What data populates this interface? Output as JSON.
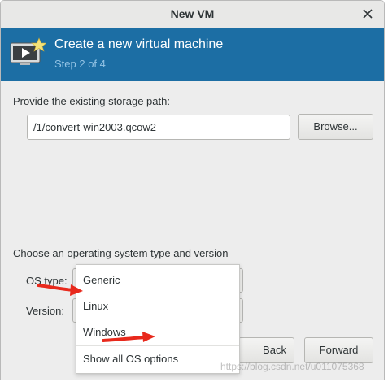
{
  "window": {
    "title": "New VM"
  },
  "banner": {
    "heading": "Create a new virtual machine",
    "step": "Step 2 of 4"
  },
  "storage": {
    "prompt": "Provide the existing storage path:",
    "path_value": "/1/convert-win2003.qcow2",
    "browse_label": "Browse..."
  },
  "os_section": {
    "prompt": "Choose an operating system type and version",
    "os_type_label": "OS type:",
    "version_label": "Version:"
  },
  "os_dropdown": {
    "options": [
      "Generic",
      "Linux",
      "Windows"
    ],
    "show_all_label": "Show all OS options"
  },
  "footer": {
    "back_label": "Back",
    "forward_label": "Forward"
  },
  "watermark": "https://blog.csdn.net/u011075368",
  "colors": {
    "banner": "#1c6ea4",
    "annotation_arrow": "#e8291c"
  }
}
